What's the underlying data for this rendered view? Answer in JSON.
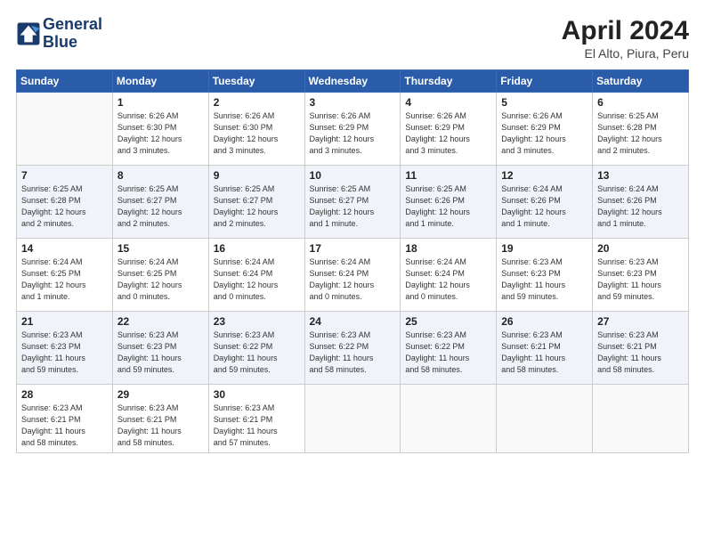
{
  "header": {
    "logo_line1": "General",
    "logo_line2": "Blue",
    "month_year": "April 2024",
    "location": "El Alto, Piura, Peru"
  },
  "days_of_week": [
    "Sunday",
    "Monday",
    "Tuesday",
    "Wednesday",
    "Thursday",
    "Friday",
    "Saturday"
  ],
  "weeks": [
    [
      {
        "day": "",
        "info": ""
      },
      {
        "day": "1",
        "info": "Sunrise: 6:26 AM\nSunset: 6:30 PM\nDaylight: 12 hours\nand 3 minutes."
      },
      {
        "day": "2",
        "info": "Sunrise: 6:26 AM\nSunset: 6:30 PM\nDaylight: 12 hours\nand 3 minutes."
      },
      {
        "day": "3",
        "info": "Sunrise: 6:26 AM\nSunset: 6:29 PM\nDaylight: 12 hours\nand 3 minutes."
      },
      {
        "day": "4",
        "info": "Sunrise: 6:26 AM\nSunset: 6:29 PM\nDaylight: 12 hours\nand 3 minutes."
      },
      {
        "day": "5",
        "info": "Sunrise: 6:26 AM\nSunset: 6:29 PM\nDaylight: 12 hours\nand 3 minutes."
      },
      {
        "day": "6",
        "info": "Sunrise: 6:25 AM\nSunset: 6:28 PM\nDaylight: 12 hours\nand 2 minutes."
      }
    ],
    [
      {
        "day": "7",
        "info": "Sunrise: 6:25 AM\nSunset: 6:28 PM\nDaylight: 12 hours\nand 2 minutes."
      },
      {
        "day": "8",
        "info": "Sunrise: 6:25 AM\nSunset: 6:27 PM\nDaylight: 12 hours\nand 2 minutes."
      },
      {
        "day": "9",
        "info": "Sunrise: 6:25 AM\nSunset: 6:27 PM\nDaylight: 12 hours\nand 2 minutes."
      },
      {
        "day": "10",
        "info": "Sunrise: 6:25 AM\nSunset: 6:27 PM\nDaylight: 12 hours\nand 1 minute."
      },
      {
        "day": "11",
        "info": "Sunrise: 6:25 AM\nSunset: 6:26 PM\nDaylight: 12 hours\nand 1 minute."
      },
      {
        "day": "12",
        "info": "Sunrise: 6:24 AM\nSunset: 6:26 PM\nDaylight: 12 hours\nand 1 minute."
      },
      {
        "day": "13",
        "info": "Sunrise: 6:24 AM\nSunset: 6:26 PM\nDaylight: 12 hours\nand 1 minute."
      }
    ],
    [
      {
        "day": "14",
        "info": "Sunrise: 6:24 AM\nSunset: 6:25 PM\nDaylight: 12 hours\nand 1 minute."
      },
      {
        "day": "15",
        "info": "Sunrise: 6:24 AM\nSunset: 6:25 PM\nDaylight: 12 hours\nand 0 minutes."
      },
      {
        "day": "16",
        "info": "Sunrise: 6:24 AM\nSunset: 6:24 PM\nDaylight: 12 hours\nand 0 minutes."
      },
      {
        "day": "17",
        "info": "Sunrise: 6:24 AM\nSunset: 6:24 PM\nDaylight: 12 hours\nand 0 minutes."
      },
      {
        "day": "18",
        "info": "Sunrise: 6:24 AM\nSunset: 6:24 PM\nDaylight: 12 hours\nand 0 minutes."
      },
      {
        "day": "19",
        "info": "Sunrise: 6:23 AM\nSunset: 6:23 PM\nDaylight: 11 hours\nand 59 minutes."
      },
      {
        "day": "20",
        "info": "Sunrise: 6:23 AM\nSunset: 6:23 PM\nDaylight: 11 hours\nand 59 minutes."
      }
    ],
    [
      {
        "day": "21",
        "info": "Sunrise: 6:23 AM\nSunset: 6:23 PM\nDaylight: 11 hours\nand 59 minutes."
      },
      {
        "day": "22",
        "info": "Sunrise: 6:23 AM\nSunset: 6:23 PM\nDaylight: 11 hours\nand 59 minutes."
      },
      {
        "day": "23",
        "info": "Sunrise: 6:23 AM\nSunset: 6:22 PM\nDaylight: 11 hours\nand 59 minutes."
      },
      {
        "day": "24",
        "info": "Sunrise: 6:23 AM\nSunset: 6:22 PM\nDaylight: 11 hours\nand 58 minutes."
      },
      {
        "day": "25",
        "info": "Sunrise: 6:23 AM\nSunset: 6:22 PM\nDaylight: 11 hours\nand 58 minutes."
      },
      {
        "day": "26",
        "info": "Sunrise: 6:23 AM\nSunset: 6:21 PM\nDaylight: 11 hours\nand 58 minutes."
      },
      {
        "day": "27",
        "info": "Sunrise: 6:23 AM\nSunset: 6:21 PM\nDaylight: 11 hours\nand 58 minutes."
      }
    ],
    [
      {
        "day": "28",
        "info": "Sunrise: 6:23 AM\nSunset: 6:21 PM\nDaylight: 11 hours\nand 58 minutes."
      },
      {
        "day": "29",
        "info": "Sunrise: 6:23 AM\nSunset: 6:21 PM\nDaylight: 11 hours\nand 58 minutes."
      },
      {
        "day": "30",
        "info": "Sunrise: 6:23 AM\nSunset: 6:21 PM\nDaylight: 11 hours\nand 57 minutes."
      },
      {
        "day": "",
        "info": ""
      },
      {
        "day": "",
        "info": ""
      },
      {
        "day": "",
        "info": ""
      },
      {
        "day": "",
        "info": ""
      }
    ]
  ]
}
